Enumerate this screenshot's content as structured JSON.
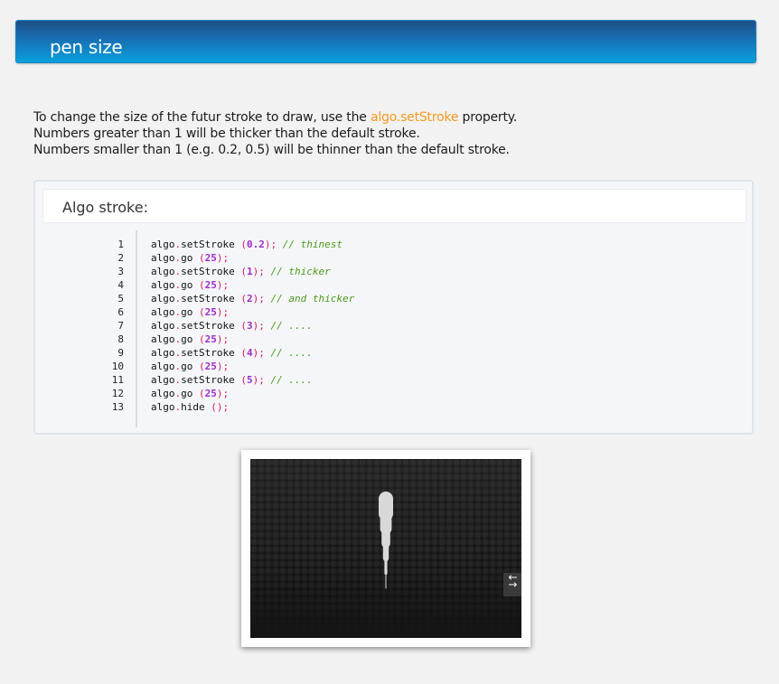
{
  "header": {
    "title": "pen size"
  },
  "intro": {
    "line1_before": "To change the size of the futur stroke to draw, use the ",
    "line1_link": "algo.setStroke",
    "line1_after": " property.",
    "line2": "Numbers greater than 1 will be thicker than the default stroke.",
    "line3": "Numbers smaller than 1 (e.g. 0.2, 0.5) will be thinner than the default stroke."
  },
  "code_panel": {
    "title": "Algo stroke:",
    "lines": [
      {
        "n": "1",
        "obj": "algo",
        "method": "setStroke",
        "arg": "0.2",
        "comment": "// thinest"
      },
      {
        "n": "2",
        "obj": "algo",
        "method": "go",
        "arg": "25",
        "comment": ""
      },
      {
        "n": "3",
        "obj": "algo",
        "method": "setStroke",
        "arg": "1",
        "comment": "// thicker"
      },
      {
        "n": "4",
        "obj": "algo",
        "method": "go",
        "arg": "25",
        "comment": ""
      },
      {
        "n": "5",
        "obj": "algo",
        "method": "setStroke",
        "arg": "2",
        "comment": "// and thicker"
      },
      {
        "n": "6",
        "obj": "algo",
        "method": "go",
        "arg": "25",
        "comment": ""
      },
      {
        "n": "7",
        "obj": "algo",
        "method": "setStroke",
        "arg": "3",
        "comment": "// ...."
      },
      {
        "n": "8",
        "obj": "algo",
        "method": "go",
        "arg": "25",
        "comment": ""
      },
      {
        "n": "9",
        "obj": "algo",
        "method": "setStroke",
        "arg": "4",
        "comment": "// ...."
      },
      {
        "n": "10",
        "obj": "algo",
        "method": "go",
        "arg": "25",
        "comment": ""
      },
      {
        "n": "11",
        "obj": "algo",
        "method": "setStroke",
        "arg": "5",
        "comment": "// ...."
      },
      {
        "n": "12",
        "obj": "algo",
        "method": "go",
        "arg": "25",
        "comment": ""
      },
      {
        "n": "13",
        "obj": "algo",
        "method": "hide",
        "arg": "",
        "comment": ""
      }
    ]
  },
  "preview": {
    "toggle_icon": "collapse-expand-icon",
    "toggle_glyph": "↓↑",
    "stroke_color": "#d8d8d8"
  }
}
